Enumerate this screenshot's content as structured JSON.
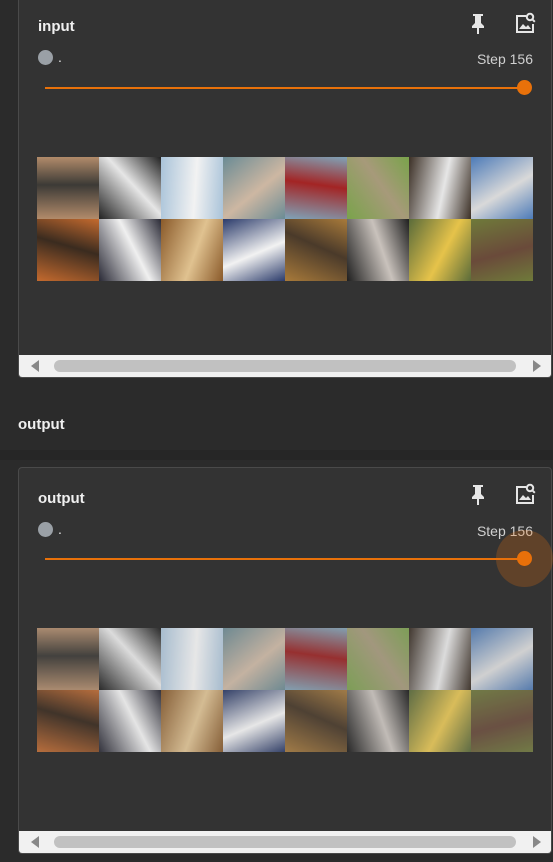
{
  "card1": {
    "title": "input",
    "run_label": ".",
    "step": "Step 156",
    "slider_value": 1.0
  },
  "section": {
    "title": "output"
  },
  "card2": {
    "title": "output",
    "run_label": ".",
    "step": "Step 156",
    "slider_value": 1.0
  },
  "colors": {
    "accent": "#e8710a",
    "run_dot": "#9aa0a6"
  },
  "icons": {
    "pin": "pin-icon",
    "image_search": "image-search-icon"
  },
  "tiles": [
    [
      "#b28b6a",
      "#3c3a36"
    ],
    [
      "#222222",
      "#e6e6e6"
    ],
    [
      "#a9c3d9",
      "#f2f2f2"
    ],
    [
      "#6a8b95",
      "#cdb7a2"
    ],
    [
      "#7fa3b8",
      "#a32424"
    ],
    [
      "#7aa34b",
      "#a79a7a"
    ],
    [
      "#3c3026",
      "#e6e6e6"
    ],
    [
      "#4d7bb8",
      "#d9d9d9"
    ],
    [
      "#c46a2e",
      "#3a2b1f"
    ],
    [
      "#2a2a36",
      "#f0f0f0"
    ],
    [
      "#8a5a2a",
      "#e0c290"
    ],
    [
      "#2b3b6b",
      "#f2f2f2"
    ],
    [
      "#a87a3a",
      "#4a3a2a"
    ],
    [
      "#1f1f1f",
      "#c9c2bc"
    ],
    [
      "#5a6b3a",
      "#e6c34a"
    ],
    [
      "#6f7a3a",
      "#6a4a3a"
    ]
  ]
}
